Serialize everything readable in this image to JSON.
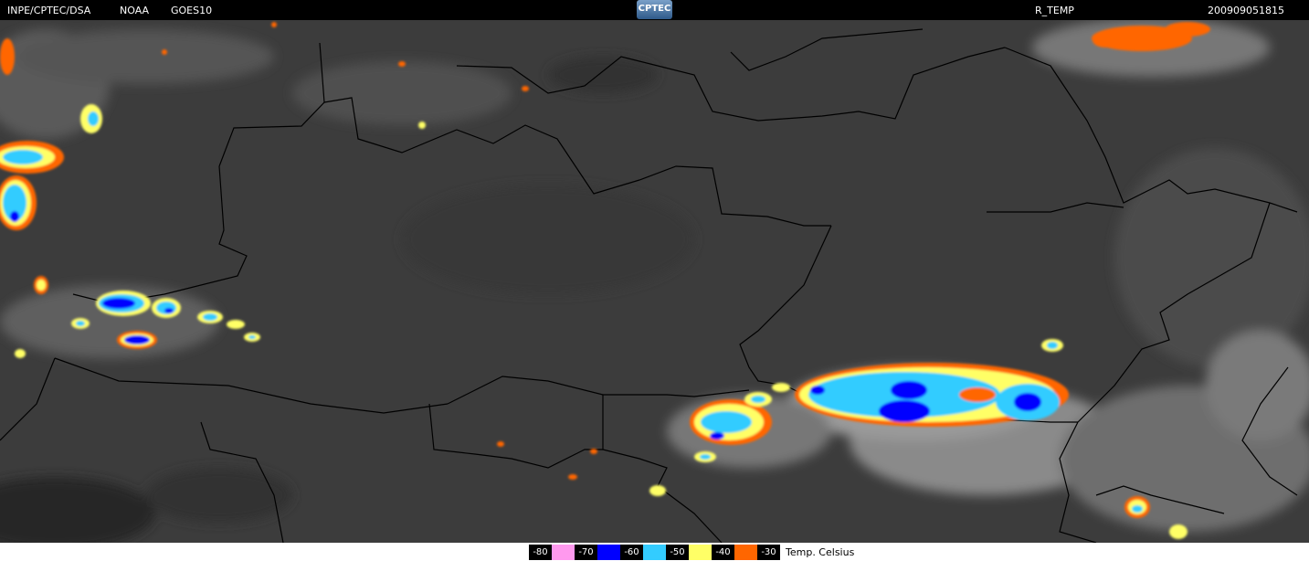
{
  "header": {
    "source": "INPE/CPTEC/DSA",
    "agency": "NOAA",
    "satellite": "GOES10",
    "logo": "CPTEC",
    "product": "R_TEMP",
    "datetime": "200909051815"
  },
  "legend": {
    "units": "Temp. Celsius",
    "scale": [
      {
        "label": "-80",
        "color": "#ff99ee"
      },
      {
        "label": "-70",
        "color": "#0000ff"
      },
      {
        "label": "-60",
        "color": "#33ccff"
      },
      {
        "label": "-50",
        "color": "#ffff66"
      },
      {
        "label": "-40",
        "color": "#ff6600"
      },
      {
        "label": "-30",
        "color": null
      }
    ]
  },
  "colors": {
    "background": "#3a3a3a",
    "borders": "#000000",
    "cloud": "#bfbfbf"
  }
}
